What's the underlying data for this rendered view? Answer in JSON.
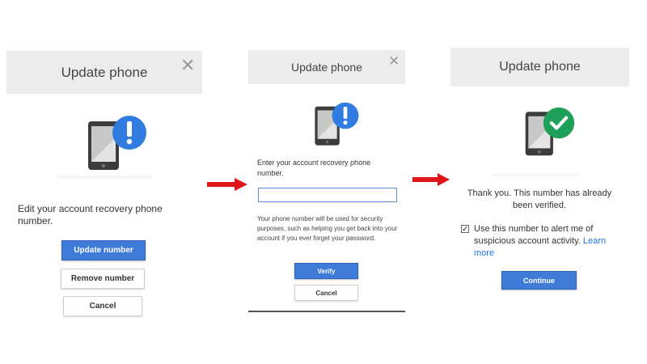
{
  "panel1": {
    "title": "Update phone",
    "description": "Edit your account recovery phone number.",
    "buttons": {
      "update": "Update number",
      "remove": "Remove number",
      "cancel": "Cancel"
    }
  },
  "panel2": {
    "title": "Update phone",
    "prompt": "Enter your account recovery phone number.",
    "input_value": "",
    "note": "Your phone number will be used for security purposes, such as helping you get back into your account if you ever forget your password.",
    "buttons": {
      "verify": "Verify",
      "cancel": "Cancel"
    }
  },
  "panel3": {
    "title": "Update phone",
    "message": "Thank you. This number has already been verified.",
    "checkbox_label": "Use this number to alert me of suspicious account activity.",
    "learn_more": "Learn more",
    "checked": true,
    "buttons": {
      "continue": "Continue"
    }
  },
  "icons": {
    "close": "close-icon",
    "alert": "exclamation-badge-icon",
    "success": "checkmark-badge-icon",
    "phone": "smartphone-icon",
    "arrow": "red-arrow-right-icon"
  },
  "colors": {
    "accent_blue": "#3e7bd9",
    "alert_blue": "#2f7de0",
    "success_green": "#1fa05a",
    "arrow_red": "#e0161b",
    "link_blue": "#1a73e8"
  }
}
